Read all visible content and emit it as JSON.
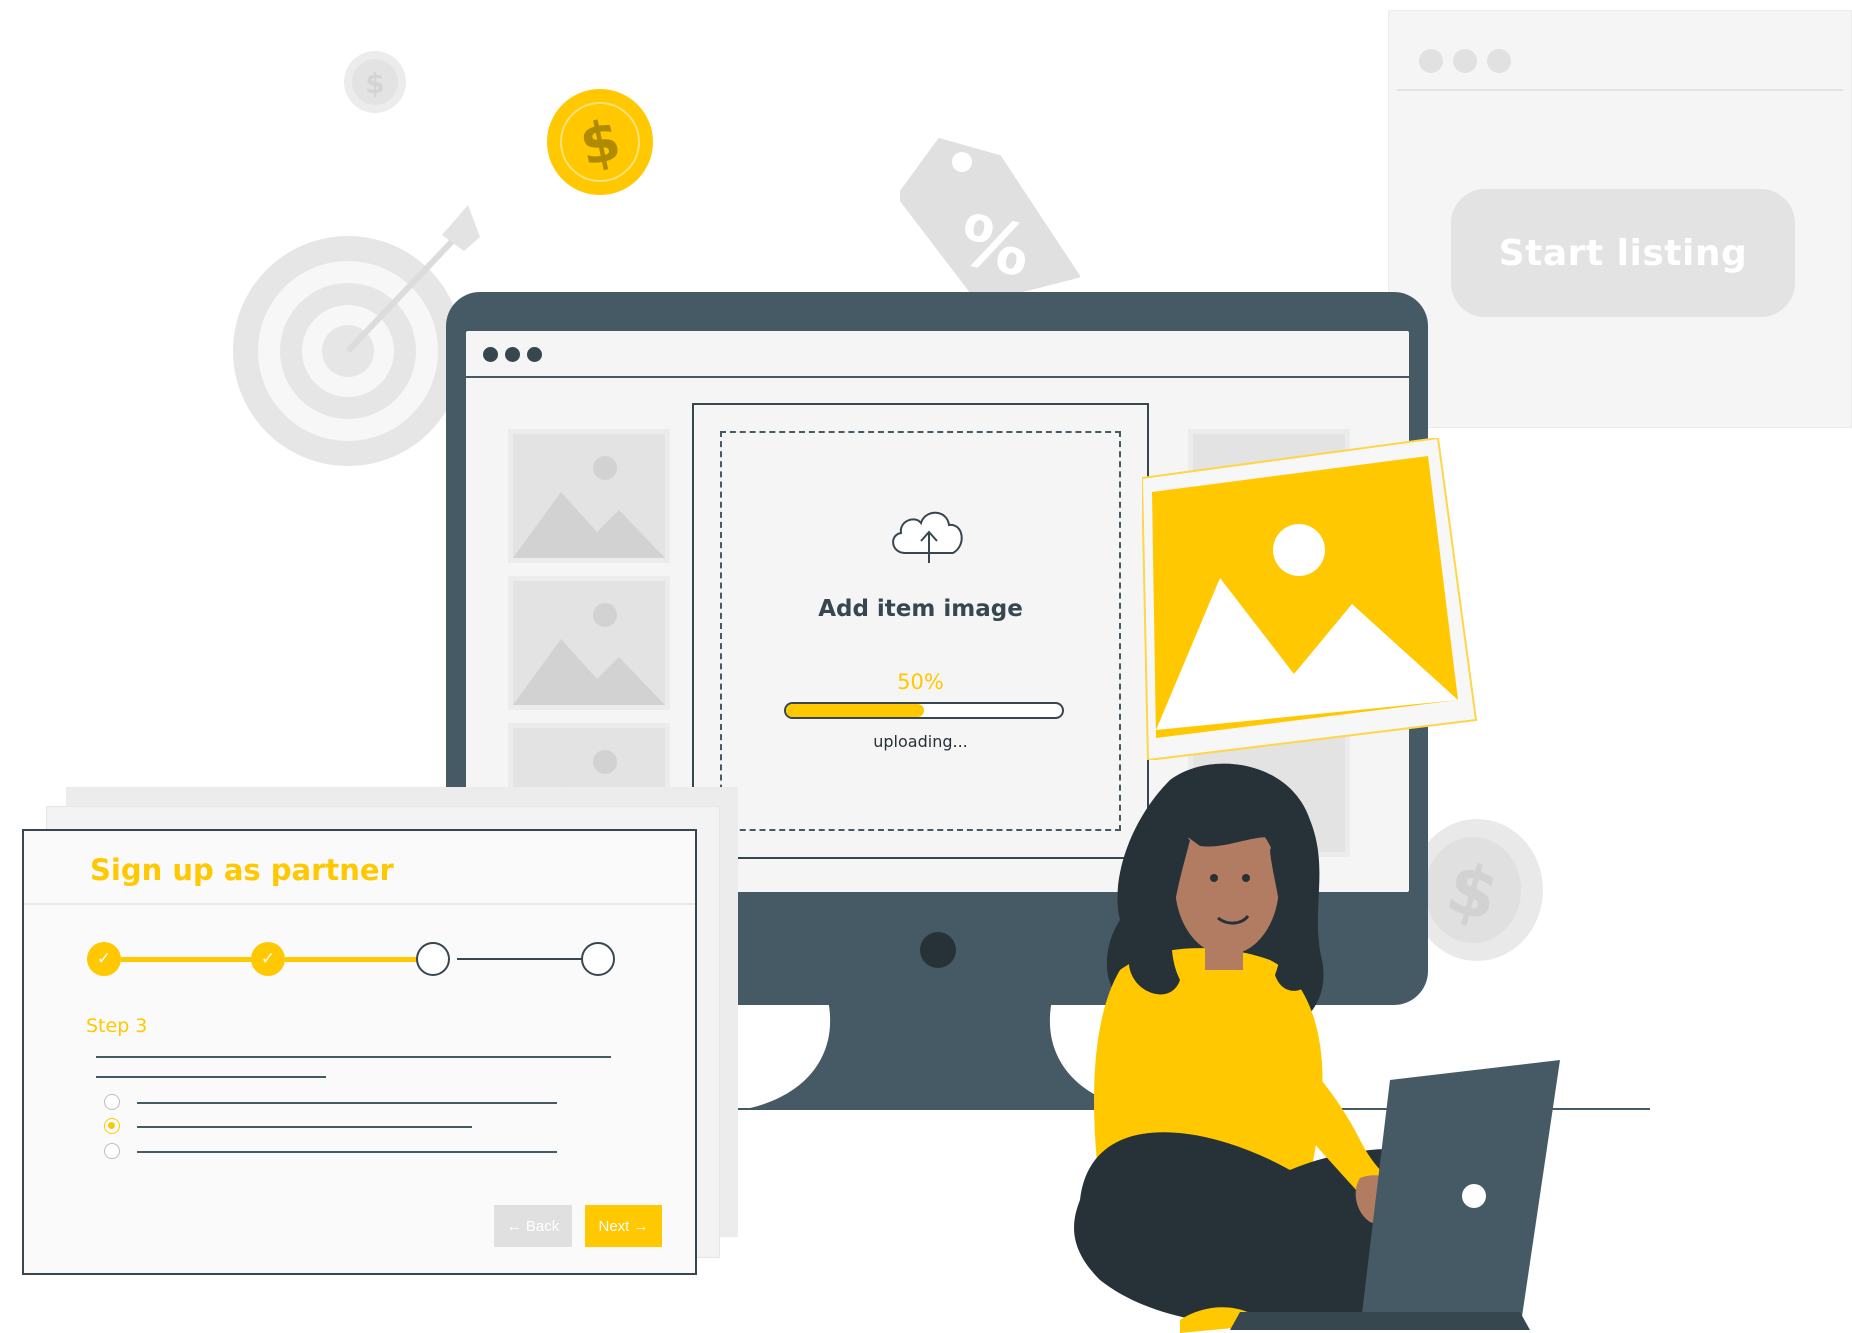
{
  "listing_window": {
    "button_label": "Start listing"
  },
  "upload": {
    "title": "Add item image",
    "percent_label": "50%",
    "progress": 0.5,
    "status": "uploading..."
  },
  "signup": {
    "title": "Sign up as partner",
    "step_label": "Step 3",
    "steps_completed": 2,
    "steps_total": 4,
    "back_label": "← Back",
    "next_label": "Next →",
    "check_mark": "✓",
    "selected_option": 2
  },
  "icons": {
    "coin_symbol": "$",
    "tag_symbol": "%"
  },
  "colors": {
    "accent": "#ffc800",
    "dark": "#455a64",
    "light_gray": "#e3e3e3"
  }
}
